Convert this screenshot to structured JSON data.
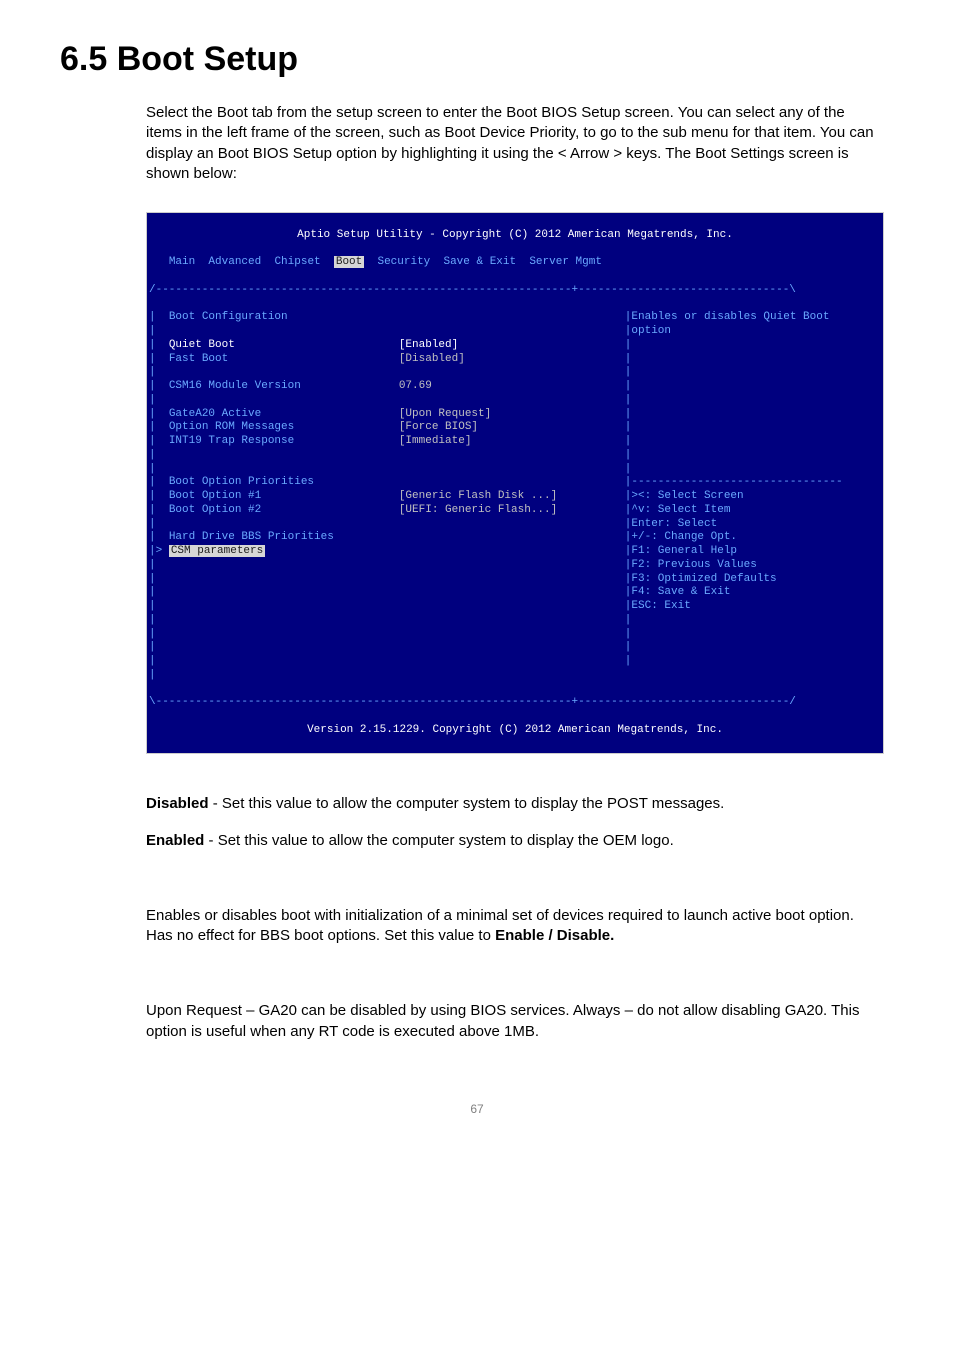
{
  "heading": "6.5 Boot Setup",
  "intro": "Select the Boot tab from the setup screen to enter the Boot BIOS Setup screen. You can select any of the items in the left frame of the screen, such as Boot Device Priority, to go to the sub menu for that item. You can display an Boot BIOS Setup option by highlighting it using the < Arrow > keys. The Boot Settings screen is shown below:",
  "bios": {
    "title": "Aptio Setup Utility - Copyright (C) 2012 American Megatrends, Inc.",
    "menu": {
      "main": "Main",
      "advanced": "Advanced",
      "chipset": "Chipset",
      "boot": "Boot",
      "security": "Security",
      "save_exit": "Save & Exit",
      "server_mgmt": "Server Mgmt"
    },
    "left": {
      "boot_config": "Boot Configuration",
      "quiet_boot_label": "Quiet Boot",
      "quiet_boot_value": "[Enabled]",
      "fast_boot_label": "Fast Boot",
      "fast_boot_value": "[Disabled]",
      "csm16_label": "CSM16 Module Version",
      "csm16_value": "07.69",
      "gatea20_label": "GateA20 Active",
      "gatea20_value": "[Upon Request]",
      "option_rom_label": "Option ROM Messages",
      "option_rom_value": "[Force BIOS]",
      "int19_label": "INT19 Trap Response",
      "int19_value": "[Immediate]",
      "priorities_header": "Boot Option Priorities",
      "opt1_label": "Boot Option #1",
      "opt1_value": "[Generic Flash Disk ...]",
      "opt2_label": "Boot Option #2",
      "opt2_value": "[UEFI: Generic Flash...]",
      "hdd_bbs": "Hard Drive BBS Priorities",
      "csm_params": "CSM parameters",
      "submenu_prefix": "> "
    },
    "right": {
      "help1": "Enables or disables Quiet Boot",
      "help2": "option",
      "nav1": "><: Select Screen",
      "nav2": "^v: Select Item",
      "nav3": "Enter: Select",
      "nav4": "+/-: Change Opt.",
      "nav5": "F1: General Help",
      "nav6": "F2: Previous Values",
      "nav7": "F3: Optimized Defaults",
      "nav8": "F4: Save & Exit",
      "nav9": "ESC: Exit"
    },
    "footer": "Version 2.15.1229. Copyright (C) 2012 American Megatrends, Inc."
  },
  "desc": {
    "disabled_label": "Disabled",
    "disabled_text": " - Set this value to allow the computer system to display the POST messages.",
    "enabled_label": "Enabled",
    "enabled_text": " - Set this value to allow the computer system to display the OEM logo.",
    "fastboot_text": "Enables or disables boot with initialization of a minimal set of devices required to launch active boot option. Has no effect for BBS boot options. Set this value to ",
    "fastboot_bold": "Enable / Disable.",
    "gatea20_text": "Upon Request – GA20 can be disabled by using BIOS services. Always – do not allow disabling GA20. This option is useful when any RT code is executed above 1MB."
  },
  "page_number": "67"
}
